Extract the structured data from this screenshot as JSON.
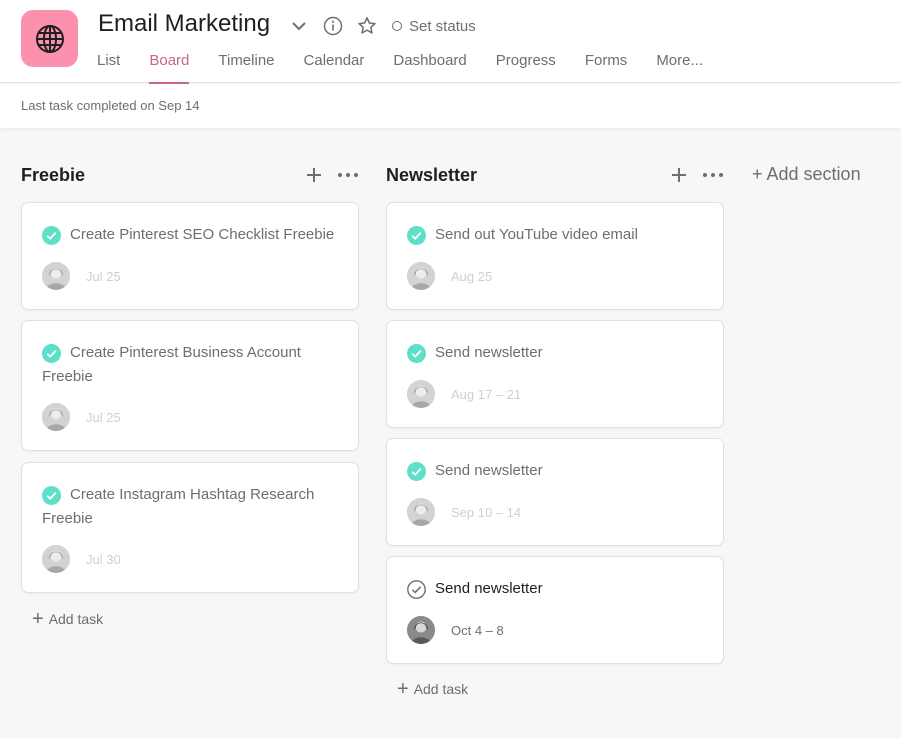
{
  "project": {
    "title": "Email Marketing",
    "icon": "globe-icon",
    "icon_bg": "#fc91ad",
    "set_status": "Set status"
  },
  "tabs": [
    {
      "label": "List"
    },
    {
      "label": "Board",
      "active": true
    },
    {
      "label": "Timeline"
    },
    {
      "label": "Calendar"
    },
    {
      "label": "Dashboard"
    },
    {
      "label": "Progress"
    },
    {
      "label": "Forms"
    },
    {
      "label": "More..."
    }
  ],
  "status_bar": {
    "text": "Last task completed on Sep 14"
  },
  "columns": [
    {
      "title": "Freebie",
      "add_task": "Add task",
      "cards": [
        {
          "title": "Create Pinterest SEO Checklist Freebie",
          "due": "Jul 25",
          "completed": true
        },
        {
          "title": "Create Pinterest Business Account Freebie",
          "due": "Jul 25",
          "completed": true
        },
        {
          "title": "Create Instagram Hashtag Research Freebie",
          "due": "Jul 30",
          "completed": true
        }
      ]
    },
    {
      "title": "Newsletter",
      "add_task": "Add task",
      "cards": [
        {
          "title": "Send out YouTube video email",
          "due": "Aug 25",
          "completed": true
        },
        {
          "title": "Send newsletter",
          "due": "Aug 17 – 21",
          "completed": true
        },
        {
          "title": "Send newsletter",
          "due": "Sep 10 – 14",
          "completed": true
        },
        {
          "title": "Send newsletter",
          "due": "Oct 4 – 8",
          "completed": false
        }
      ]
    }
  ],
  "add_section": "+ Add section",
  "colors": {
    "accent": "#c9687f",
    "check": "#5ee0c8",
    "muted_text": "#6d6e6f"
  }
}
